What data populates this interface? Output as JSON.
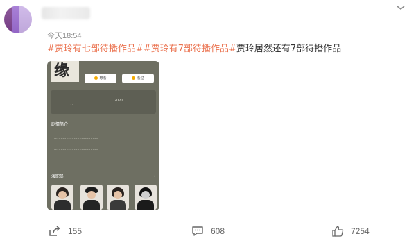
{
  "post": {
    "time": "今天18:54",
    "content": {
      "tag1": "#贾玲有七部待播作品#",
      "tag2": "#贾玲有7部待播作品#",
      "text": "贾玲居然还有7部待播作品"
    },
    "menu_icon": "chevron-down-icon"
  },
  "image": {
    "poster_glyph": "缘",
    "buttons": [
      "想看",
      "看过"
    ],
    "section_intro_title": "剧情简介",
    "section_cast_title": "演职员",
    "info_year": "2021"
  },
  "actions": {
    "repost_count": "155",
    "comment_count": "608",
    "like_count": "7254",
    "icons": [
      "share-icon",
      "comment-icon",
      "like-icon"
    ]
  }
}
